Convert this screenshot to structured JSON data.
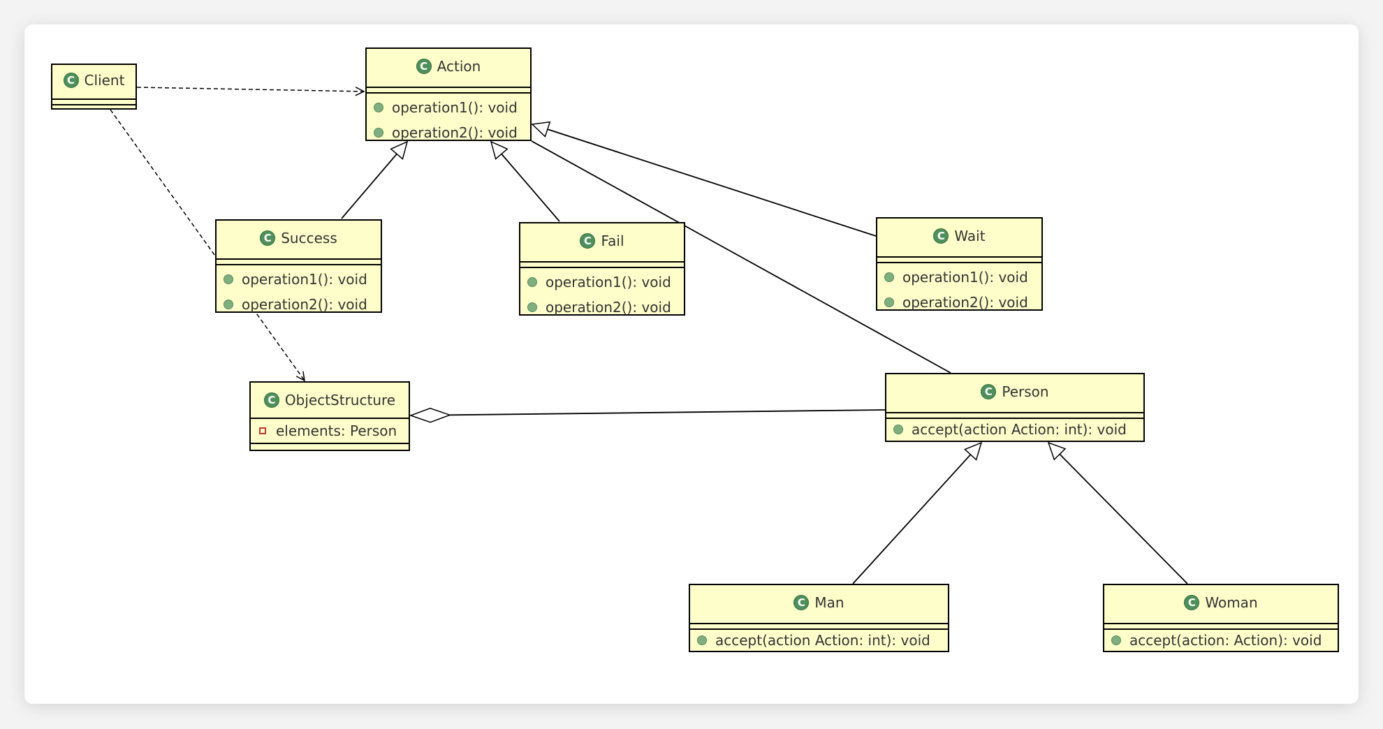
{
  "classes": {
    "client": {
      "name": "Client",
      "members": []
    },
    "action": {
      "name": "Action",
      "members": [
        "operation1(): void",
        "operation2(): void"
      ]
    },
    "success": {
      "name": "Success",
      "members": [
        "operation1(): void",
        "operation2(): void"
      ]
    },
    "fail": {
      "name": "Fail",
      "members": [
        "operation1(): void",
        "operation2(): void"
      ]
    },
    "wait": {
      "name": "Wait",
      "members": [
        "operation1(): void",
        "operation2(): void"
      ]
    },
    "object_structure": {
      "name": "ObjectStructure",
      "fields": [
        "elements: Person"
      ]
    },
    "person": {
      "name": "Person",
      "members": [
        "accept(action Action: int): void"
      ]
    },
    "man": {
      "name": "Man",
      "members": [
        "accept(action Action: int): void"
      ]
    },
    "woman": {
      "name": "Woman",
      "members": [
        "accept(action: Action): void"
      ]
    }
  },
  "class_icon": "C",
  "relations": [
    {
      "from": "Client",
      "to": "Action",
      "type": "dependency"
    },
    {
      "from": "Client",
      "to": "ObjectStructure",
      "type": "dependency"
    },
    {
      "from": "Success",
      "to": "Action",
      "type": "generalization"
    },
    {
      "from": "Fail",
      "to": "Action",
      "type": "generalization"
    },
    {
      "from": "Wait",
      "to": "Action",
      "type": "generalization"
    },
    {
      "from": "Person",
      "to": "Action",
      "type": "association"
    },
    {
      "from": "ObjectStructure",
      "to": "Person",
      "type": "aggregation"
    },
    {
      "from": "Man",
      "to": "Person",
      "type": "generalization"
    },
    {
      "from": "Woman",
      "to": "Person",
      "type": "generalization"
    }
  ],
  "colors": {
    "class_fill": "#fefecb",
    "icon_green": "#4f8f5b",
    "method_dot": "#7fae7f",
    "private_marker": "#c0392b"
  }
}
